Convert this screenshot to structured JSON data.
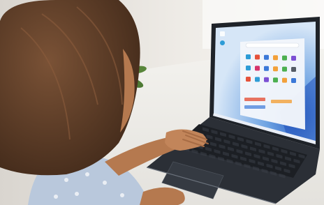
{
  "photo": {
    "subject": "person-using-laptop",
    "colors": {
      "wall": "#ece8e2",
      "table": "#f6f5f2",
      "hair": "#5b3a26",
      "skin": "#b5794f",
      "shirt": "#b9c8dc",
      "laptop_body": "#2b2f36",
      "keyboard": "#1c1f24",
      "screen_wallpaper": "#9fc3e8",
      "start_menu": "#f3f6fb",
      "plant": "#4e7a34",
      "pot": "#2d2d2d"
    }
  },
  "screen": {
    "os": "Windows 11",
    "start_menu_visible": true,
    "taskbar_visible": true
  }
}
